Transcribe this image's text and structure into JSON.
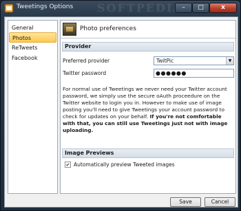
{
  "window": {
    "title": "Tweetings Options",
    "watermark": "SOFTPEDIA",
    "controls": {
      "minimize": "–",
      "maximize": "□",
      "close": "x"
    }
  },
  "sidebar": {
    "items": [
      {
        "label": "General",
        "active": false
      },
      {
        "label": "Photos",
        "active": true
      },
      {
        "label": "ReTweets",
        "active": false
      },
      {
        "label": "Facebook",
        "active": false
      }
    ]
  },
  "panel": {
    "title": "Photo preferences",
    "provider_section": {
      "heading": "Provider",
      "preferred_provider_label": "Preferred provider",
      "preferred_provider_value": "TwitPic",
      "password_label": "Twitter password",
      "password_value": "●●●●●●"
    },
    "info_normal": "For normal use of Tweetings we never need your Twitter account password, we simply use the secure oAuth proceedure on the Twitter website to login you in. However to make use of image posting you'll need to give Tweetings your account password to check for updates on your behalf.",
    "info_bold": "If you're not comfortable with that, you can still use Tweetings just not with image uploading.",
    "image_previews_section": {
      "heading": "Image Previews",
      "auto_preview_label": "Automatically preview Tweeted images",
      "auto_preview_checked": true
    }
  },
  "footer": {
    "save_label": "Save",
    "cancel_label": "Cancel"
  },
  "icons": {
    "app": "tweetings-app-icon",
    "photo": "photo-preferences-icon",
    "dropdown": "chevron-down-icon",
    "check": "check-icon"
  },
  "colors": {
    "selected_tab": "#ffc94d",
    "section_header": "#d4dde7",
    "titlebar": "#28394b"
  }
}
